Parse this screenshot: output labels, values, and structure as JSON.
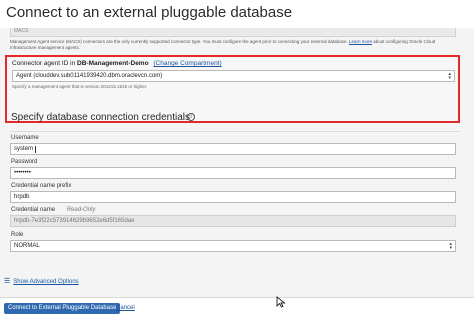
{
  "header": {
    "title": "Connect to an external pluggable database"
  },
  "top": {
    "select_value": "MACS",
    "help_text": "Management Agent service (MACS) connectors are the only currently supported connector type. You must configure the agent prior to connecting your external database.",
    "help_link": "Learn more",
    "help_text_after": "about configuring Oracle Cloud Infrastructure management agents."
  },
  "connector": {
    "label_prefix": "Connector agent ID in",
    "compartment": "DB-Management-Demo",
    "change_link": "(Change Compartment)",
    "value": "Agent (clouddev.sub01141939420.dbm.oraclevcn.com)",
    "hint": "Specify a management agent that is version 201215.1615 or higher."
  },
  "credentials": {
    "title": "Specify database connection credentials",
    "username_label": "Username",
    "username_value": "system",
    "password_label": "Password",
    "password_value": "••••••••",
    "cred_prefix_label": "Credential name prefix",
    "cred_prefix_value": "hrpdb",
    "cred_name_label": "Credential name",
    "cred_name_readonly": "Read-Only",
    "cred_name_value": "hrpdb-7e3f22c573914629b9652e6d5f165dae",
    "role_label": "Role",
    "role_value": "NORMAL"
  },
  "advanced": {
    "label": "Show Advanced Options"
  },
  "footer": {
    "primary": "Connect to External Pluggable Database",
    "cancel": "Cancel"
  }
}
